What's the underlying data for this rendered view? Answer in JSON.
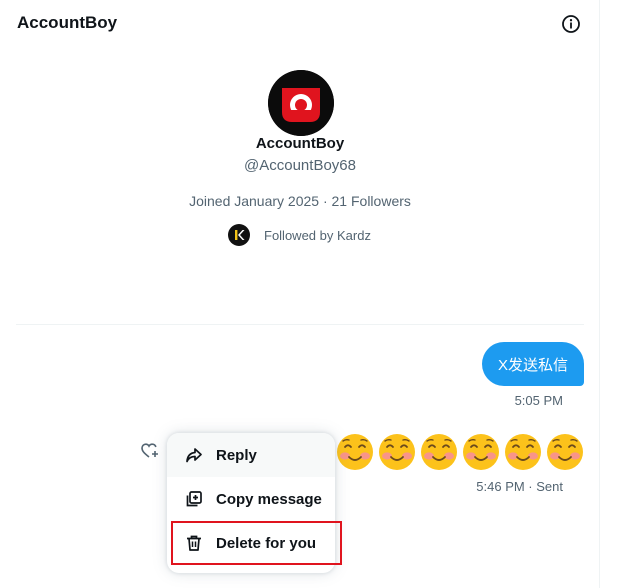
{
  "header": {
    "title": "AccountBoy",
    "info_icon": "info-circle-icon"
  },
  "profile": {
    "name": "AccountBoy",
    "handle": "@AccountBoy68",
    "joined": "Joined January 2025 · 21 Followers",
    "followed_by": "Followed by Kardz",
    "avatar_colors": {
      "background": "#0b0b0b",
      "accent": "#e0141e"
    }
  },
  "messages": [
    {
      "text": "X发送私信",
      "time": "5:05 PM",
      "bubble_color": "#1d9bf0"
    },
    {
      "emoji": "☺️",
      "emoji_count": 9,
      "time": "5:46 PM · Sent"
    }
  ],
  "context_menu": {
    "items": [
      {
        "label": "Reply",
        "icon": "reply-icon"
      },
      {
        "label": "Copy message",
        "icon": "copy-icon"
      },
      {
        "label": "Delete for you",
        "icon": "trash-icon"
      }
    ],
    "highlight_color": "#e0141e"
  }
}
